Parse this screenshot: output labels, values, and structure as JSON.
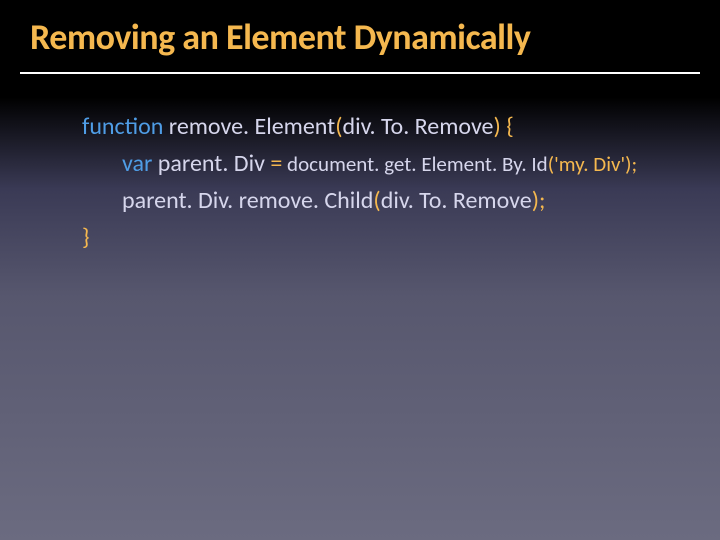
{
  "title": "Removing an Element Dynamically",
  "code": {
    "line1": {
      "kw": "function",
      "space": " ",
      "name": "remove. Element",
      "lparen": "(",
      "param": "div. To. Remove",
      "rparen": ")",
      "brace": " {"
    },
    "line2": {
      "kw": "var",
      "space": " ",
      "varname": "parent. Div ",
      "eq": "=",
      "after": " document. get. Element. By. Id",
      "lparen": "(",
      "str": "'my. Div'",
      "rparen": ")",
      "semi": ";"
    },
    "line3": {
      "text1": "parent. Div. remove. Child",
      "lparen": "(",
      "arg": "div. To. Remove",
      "rparen": ")",
      "semi": ";"
    },
    "line4": {
      "brace": "}"
    }
  }
}
